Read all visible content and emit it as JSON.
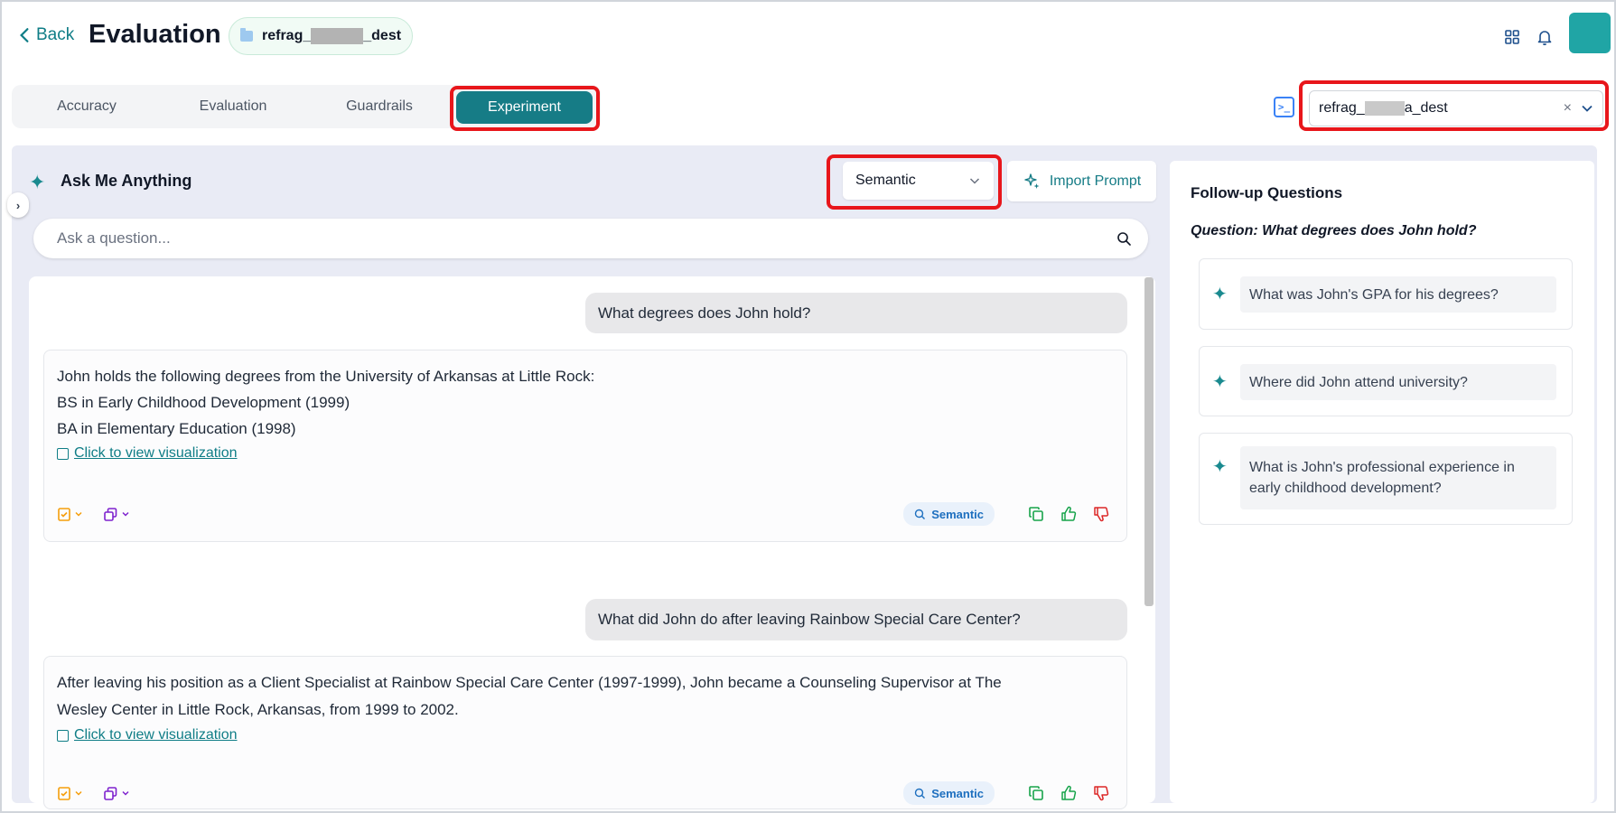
{
  "header": {
    "back_label": "Back",
    "title": "Evaluation",
    "dataset_chip_prefix": "refrag_",
    "dataset_chip_suffix": "_dest"
  },
  "tabs": [
    {
      "label": "Accuracy",
      "active": false
    },
    {
      "label": "Evaluation",
      "active": false
    },
    {
      "label": "Guardrails",
      "active": false
    },
    {
      "label": "Experiment",
      "active": true
    }
  ],
  "dataset_select": {
    "value_prefix": "refrag_",
    "value_suffix": "a_dest",
    "clear_icon": "×"
  },
  "ama": {
    "title": "Ask Me Anything",
    "mode": "Semantic",
    "import_label": "Import Prompt",
    "placeholder": "Ask a question..."
  },
  "chat": [
    {
      "question": "What degrees does John hold?",
      "answer_lines": [
        "John holds the following degrees from the University of Arkansas at Little Rock:",
        "BS in Early Childhood Development (1999)",
        "BA in Elementary Education (1998)"
      ],
      "link": "Click to view visualization",
      "badge": "Semantic"
    },
    {
      "question": "What did John do after leaving Rainbow Special Care Center?",
      "answer_lines": [
        "After leaving his position as a Client Specialist at Rainbow Special Care Center (1997-1999), John became a Counseling Supervisor at The",
        "Wesley Center in Little Rock, Arkansas, from 1999 to 2002."
      ],
      "link": "Click to view visualization",
      "badge": "Semantic"
    }
  ],
  "followup": {
    "title": "Follow-up Questions",
    "question": "Question: What degrees does John hold?",
    "items": [
      "What was John's GPA for his degrees?",
      "Where did John attend university?",
      "What is John's professional experience in early childhood development?"
    ]
  },
  "colors": {
    "accent": "#167c86",
    "highlight": "#e8161b",
    "avatar": "#20a5a5",
    "panel_bg": "#e9ebf5"
  },
  "icons": [
    "chevron-left-icon",
    "folder-icon",
    "grid-icon",
    "bell-icon",
    "terminal-icon",
    "sparkle-icon",
    "search-icon",
    "chevron-down-icon",
    "copy-icon",
    "thumbs-up-icon",
    "thumbs-down-icon",
    "image-icon",
    "checklist-icon",
    "layers-icon"
  ]
}
